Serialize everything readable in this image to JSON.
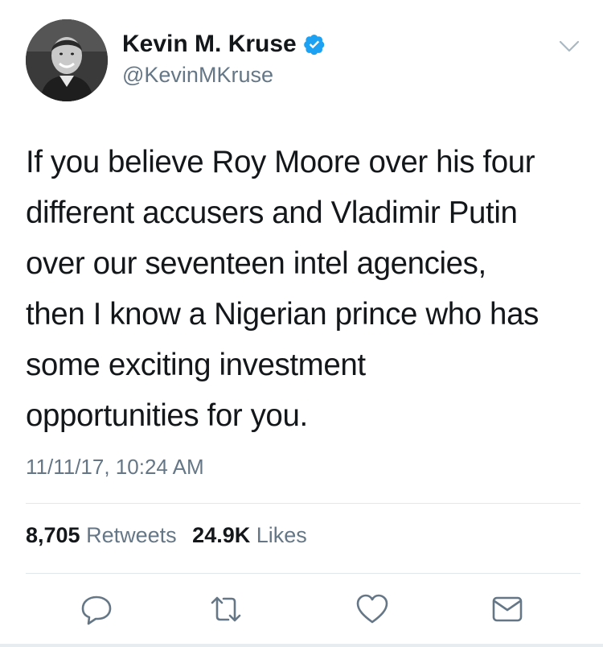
{
  "author": {
    "display_name": "Kevin M. Kruse",
    "handle": "@KevinMKruse",
    "verified": true
  },
  "tweet": {
    "text_lines": [
      "If you believe Roy Moore over his four",
      "different accusers and Vladimir Putin",
      "over our seventeen intel agencies,",
      "then I know a Nigerian prince who has",
      "some exciting investment",
      "opportunities for you."
    ],
    "timestamp": "11/11/17, 10:24 AM"
  },
  "stats": {
    "retweets_count": "8,705",
    "retweets_label": "Retweets",
    "likes_count": "24.9K",
    "likes_label": "Likes"
  },
  "icons": {
    "verified": "verified-badge-icon",
    "menu": "chevron-down-icon",
    "reply": "reply-icon",
    "retweet": "retweet-icon",
    "like": "heart-icon",
    "dm": "envelope-icon"
  },
  "colors": {
    "text": "#14171a",
    "secondary": "#657786",
    "verified": "#1da1f2",
    "divider": "#e1e8ed"
  }
}
